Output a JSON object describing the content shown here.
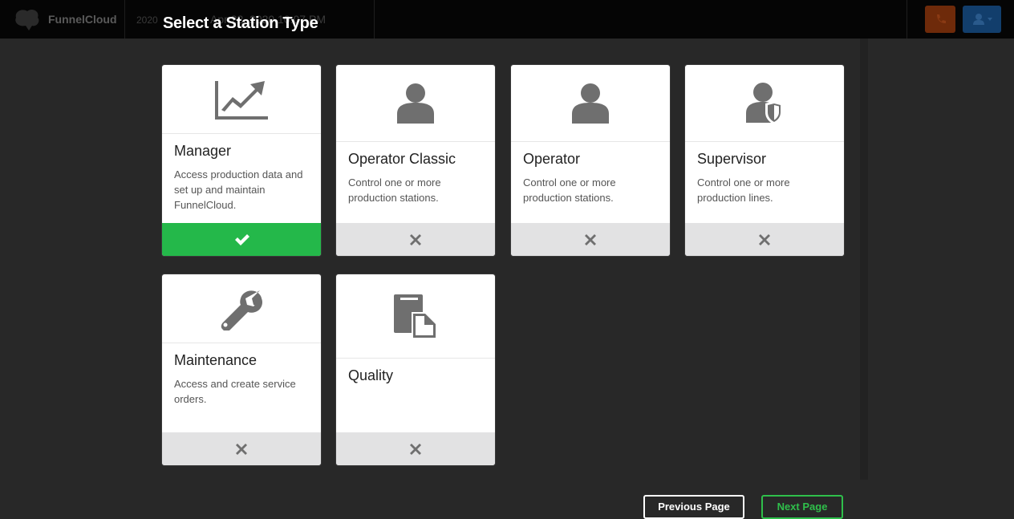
{
  "app": {
    "brand": "FunnelCloud",
    "year_fragment": "2020",
    "datetime": "Apr 22, 2020 10:07 PM"
  },
  "modal": {
    "title": "Select a Station Type",
    "prev_label": "Previous Page",
    "next_label": "Next Page"
  },
  "stations": [
    {
      "title": "Manager",
      "description": "Access production data and set up and maintain FunnelCloud.",
      "selected": true,
      "icon": "chart-line-icon"
    },
    {
      "title": "Operator Classic",
      "description": "Control one or more production stations.",
      "selected": false,
      "icon": "user-icon"
    },
    {
      "title": "Operator",
      "description": "Control one or more production stations.",
      "selected": false,
      "icon": "user-icon"
    },
    {
      "title": "Supervisor",
      "description": "Control one or more production lines.",
      "selected": false,
      "icon": "user-shield-icon"
    },
    {
      "title": "Maintenance",
      "description": "Access and create service orders.",
      "selected": false,
      "icon": "wrench-icon"
    },
    {
      "title": "Quality",
      "description": "",
      "selected": false,
      "icon": "documents-icon"
    }
  ],
  "colors": {
    "selected": "#24b84a",
    "unselected": "#e2e2e3",
    "icon": "#6f6f6f"
  }
}
